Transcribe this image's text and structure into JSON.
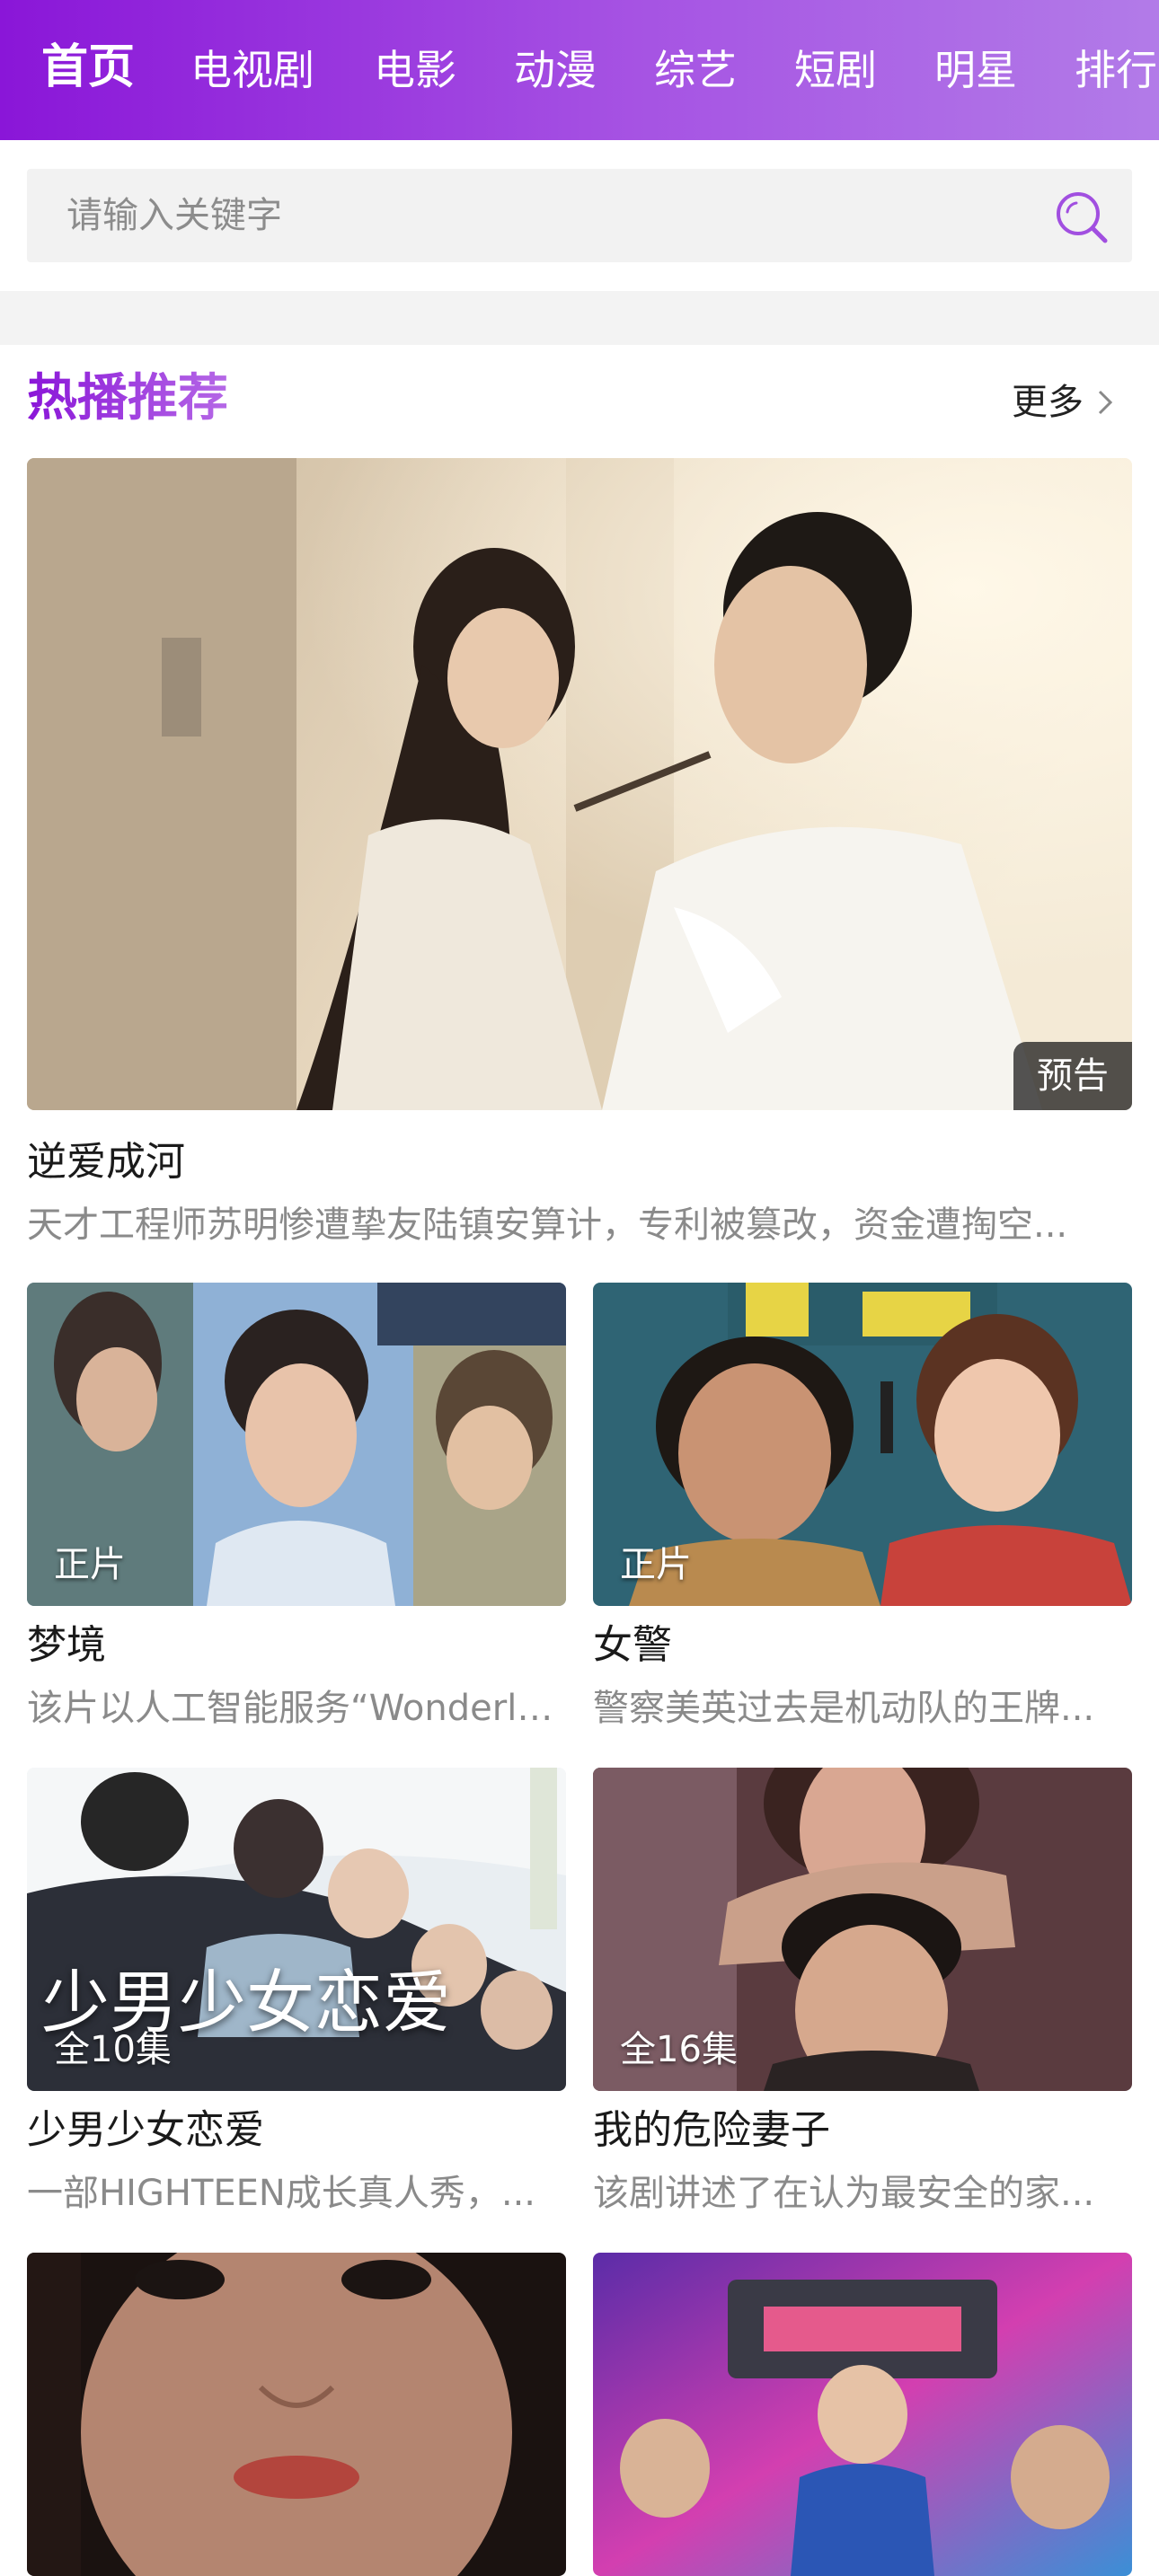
{
  "nav": {
    "tabs": [
      "首页",
      "电视剧",
      "电影",
      "动漫",
      "综艺",
      "短剧",
      "明星",
      "排行"
    ],
    "active_index": 0
  },
  "search": {
    "placeholder": "请输入关键字",
    "icon": "search-icon"
  },
  "section": {
    "title": "热播推荐",
    "more_label": "更多"
  },
  "featured": {
    "badge": "预告",
    "title": "逆爱成河",
    "desc": "天才工程师苏明惨遭挚友陆镇安算计，专利被篡改，资金遭掏空..."
  },
  "grid": [
    {
      "badge": "正片",
      "title": "梦境",
      "desc": "该片以人工智能服务“Wonderland”..."
    },
    {
      "badge": "正片",
      "title": "女警",
      "desc": "警察美英过去是机动队的王牌..."
    },
    {
      "badge": "全10集",
      "title": "少男少女恋爱",
      "desc": "一部HIGHTEEN成长真人秀，...",
      "overlay_text": "少男少女恋爱"
    },
    {
      "badge": "全16集",
      "title": "我的危险妻子",
      "desc": "该剧讲述了在认为最安全的家..."
    },
    {
      "badge": "",
      "title": "",
      "desc": ""
    },
    {
      "badge": "",
      "title": "",
      "desc": ""
    }
  ],
  "colors": {
    "brand_start": "#8a16d8",
    "brand_end": "#b27be8",
    "badge_bg": "#141414"
  }
}
